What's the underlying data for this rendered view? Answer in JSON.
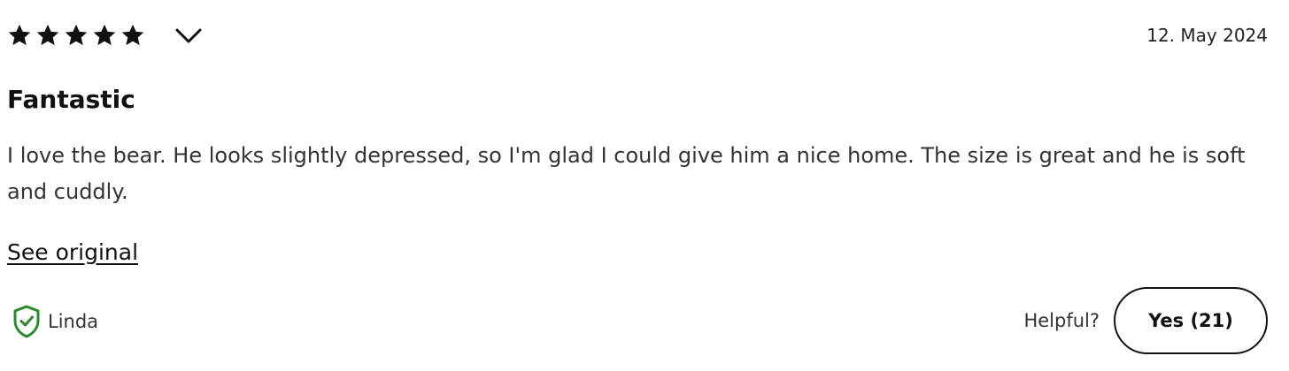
{
  "review": {
    "rating": 5,
    "rating_max": 5,
    "date": "12. May 2024",
    "title": "Fantastic",
    "body": "I love the bear. He looks slightly depressed, so I'm glad I could give him a nice home. The size is great and he is soft and cuddly.",
    "see_original_label": "See original",
    "author": "Linda",
    "helpful_label": "Helpful?",
    "yes_button_label": "Yes (21)"
  },
  "icons": {
    "star": "star-icon",
    "expand": "chevron-down-icon",
    "verified": "shield-check-icon"
  },
  "colors": {
    "star": "#111111",
    "verified_shield": "#2a8a2a",
    "text": "#333333"
  }
}
